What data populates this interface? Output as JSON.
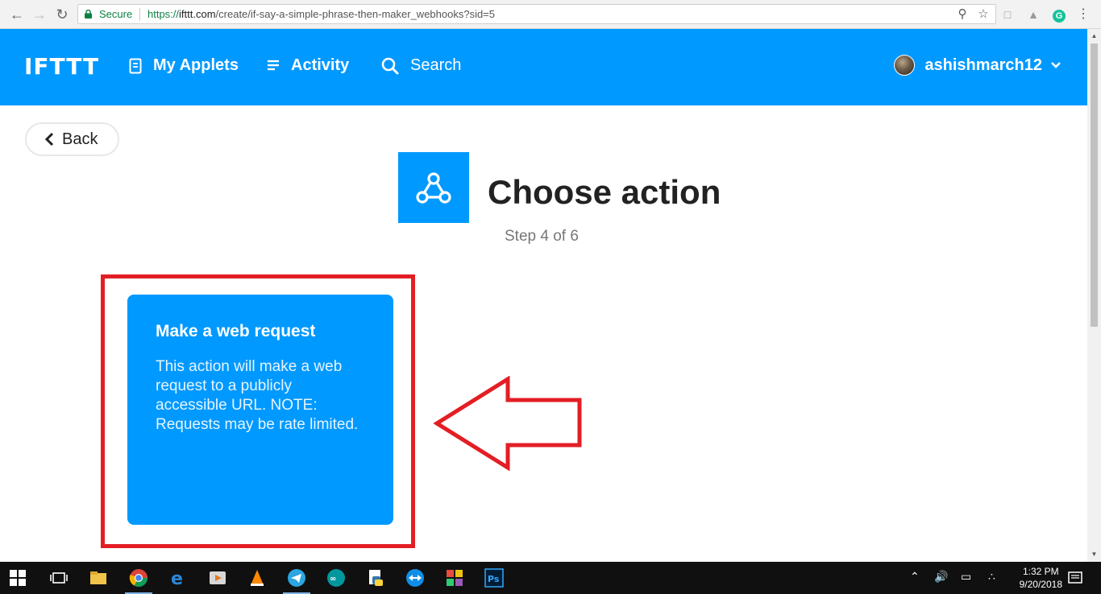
{
  "browser": {
    "secure_label": "Secure",
    "url_scheme": "https://",
    "url_host": "ifttt.com",
    "url_path": "/create/if-say-a-simple-phrase-then-maker_webhooks?sid=5",
    "icons": [
      "back-icon",
      "forward-icon",
      "reload-icon",
      "lock-icon",
      "zoom-icon",
      "star-icon",
      "extension-icons",
      "menu-icon"
    ]
  },
  "header": {
    "logo": "IFTTT",
    "nav": {
      "my_applets": "My Applets",
      "activity": "Activity",
      "search": "Search"
    },
    "username": "ashishmarch12",
    "background_color": "#0099ff"
  },
  "page": {
    "back_label": "Back",
    "title": "Choose action",
    "step": "Step 4 of 6",
    "service_icon": "webhooks-icon"
  },
  "action_card": {
    "title": "Make a web request",
    "description": "This action will make a web request to a publicly accessible URL. NOTE: Requests may be rate limited.",
    "highlight_color": "#e31e24"
  },
  "taskbar": {
    "time": "1:32 PM",
    "date": "9/20/2018"
  }
}
